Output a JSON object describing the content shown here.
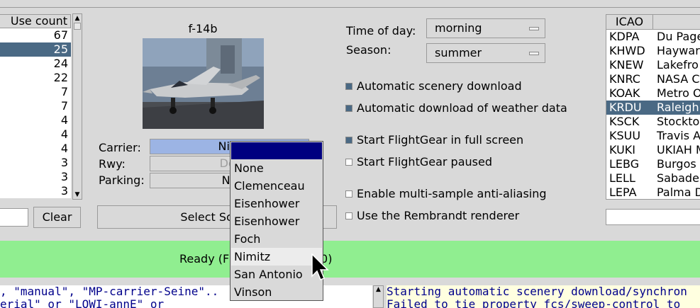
{
  "aircraft_list": {
    "column_header": "Use count",
    "counts": [
      "67",
      "25",
      "24",
      "22",
      "7",
      "7",
      "4",
      "4",
      "4",
      "3",
      "3",
      "3"
    ],
    "selected_index": 1
  },
  "filter": {
    "clear_label": "Clear"
  },
  "aircraft": {
    "name": "f-14b",
    "image_icon": "aircraft-carrier-photo"
  },
  "carrier_fields": {
    "carrier_label": "Carrier:",
    "carrier_value": "Nim",
    "rwy_label": "Rwy:",
    "rwy_value": "Def",
    "parking_label": "Parking:",
    "parking_value": "No",
    "scenario_button": "Select Scena"
  },
  "environment": {
    "time_label": "Time of day:",
    "time_value": "morning",
    "season_label": "Season:",
    "season_value": "summer"
  },
  "options": [
    {
      "label": "Automatic scenery download",
      "checked": true
    },
    {
      "label": "Automatic download of weather data",
      "checked": true
    },
    {
      "label": "Start FlightGear in full screen",
      "checked": true
    },
    {
      "label": "Start FlightGear paused",
      "checked": false
    },
    {
      "label": "Enable multi-sample anti-aliasing",
      "checked": false
    },
    {
      "label": "Use the Rembrandt renderer",
      "checked": false
    }
  ],
  "airports": {
    "header": "ICAO",
    "rows": [
      {
        "icao": "KDPA",
        "name": "Du Page"
      },
      {
        "icao": "KHWD",
        "name": "Haywar"
      },
      {
        "icao": "KNEW",
        "name": "Lakefro"
      },
      {
        "icao": "KNRC",
        "name": "NASA Cr"
      },
      {
        "icao": "KOAK",
        "name": "Metro O"
      },
      {
        "icao": "KRDU",
        "name": "Raleigh"
      },
      {
        "icao": "KSCK",
        "name": "Stockto"
      },
      {
        "icao": "KSUU",
        "name": "Travis A"
      },
      {
        "icao": "KUKI",
        "name": "UKIAH M"
      },
      {
        "icao": "LEBG",
        "name": "Burgos"
      },
      {
        "icao": "LELL",
        "name": "Sabadel"
      },
      {
        "icao": "LEPA",
        "name": "Palma D"
      }
    ],
    "selected_index": 5
  },
  "status": {
    "left_text": "Ready (F",
    "right_text": "s: 0)",
    "color": "#90ee90"
  },
  "command_pane": {
    "line1": ", \"manual\", \"MP-carrier-Seine\"..",
    "line2": "erial\" or \"LOWI-annE\" or"
  },
  "log_pane": {
    "line1": "Starting automatic scenery download/synchron",
    "line2": "Failed to tie property fcs/sweep-control to"
  },
  "carrier_menu": {
    "items": [
      "None",
      "Clemenceau",
      "Eisenhower",
      "Eisenhower",
      "Foch",
      "Nimitz",
      "San Antonio",
      "Vinson"
    ],
    "hover_index": 5
  }
}
